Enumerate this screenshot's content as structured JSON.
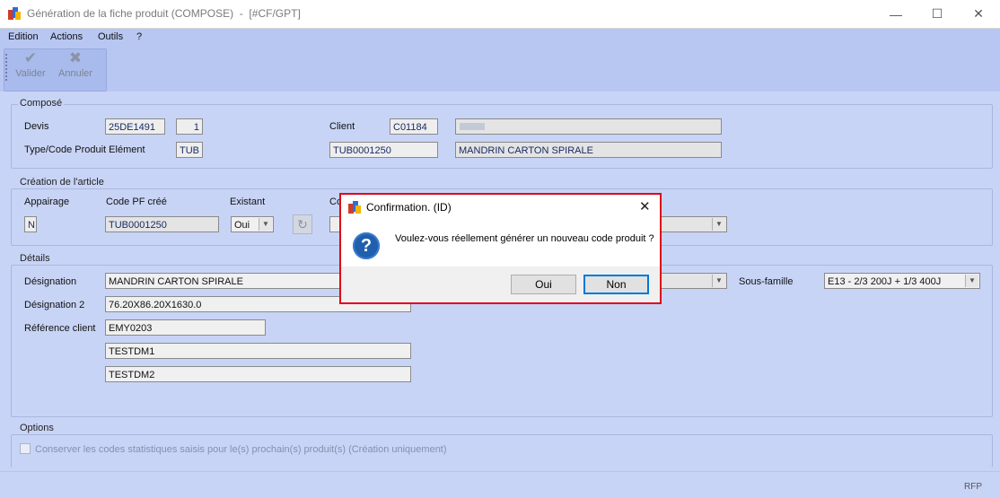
{
  "window": {
    "title": "Génération de la fiche produit (COMPOSE)  -  [#CF/GPT]",
    "controls": [
      "—",
      "☐",
      "✕"
    ]
  },
  "menu": [
    "Edition",
    "Actions",
    "Outils",
    "?"
  ],
  "toolbar": {
    "validate_label": "Valider",
    "cancel_label": "Annuler"
  },
  "compose": {
    "title": "Composé",
    "devis_label": "Devis",
    "devis_value": "25DE1491",
    "devis_index": "1",
    "type_label": "Type/Code Produit Elément",
    "type_value": "TUB",
    "client_label": "Client",
    "client_code": "C01184",
    "client_name": "",
    "product_code": "TUB0001250",
    "product_name": "MANDRIN CARTON SPIRALE"
  },
  "creation": {
    "title": "Création de l'article",
    "appairage_label": "Appairage",
    "appairage_value": "N",
    "code_label": "Code PF créé",
    "code_value": "TUB0001250",
    "existant_label": "Existant",
    "existant_value": "Oui",
    "partial_label": "Co"
  },
  "details": {
    "title": "Détails",
    "designation_label": "Désignation",
    "designation_value": "MANDRIN CARTON SPIRALE",
    "designation2_label": "Désignation 2",
    "designation2_value": "76.20X86.20X1630.0",
    "reference_label": "Référence client",
    "reference_value": "EMY0203",
    "extra1": "TESTDM1",
    "extra2": "TESTDM2",
    "sousfamille_label": "Sous-famille",
    "sousfamille_value": "E13 - 2/3 200J + 1/3 400J"
  },
  "options": {
    "title": "Options",
    "checkbox_label": "Conserver les codes statistiques saisis pour le(s) prochain(s) produit(s) (Création uniquement)"
  },
  "statusbar": {
    "text": "RFP"
  },
  "dialog": {
    "title": "Confirmation.   (ID)",
    "message": "Voulez-vous réellement générer un nouveau code produit ?",
    "yes": "Oui",
    "no": "Non",
    "icon": "question-icon"
  }
}
